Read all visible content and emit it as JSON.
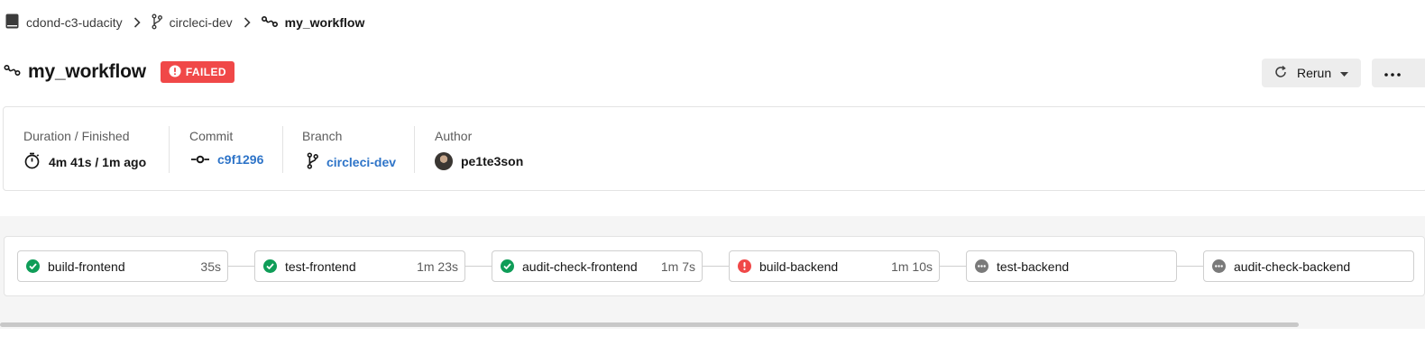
{
  "breadcrumb": {
    "project": "cdond-c3-udacity",
    "branch": "circleci-dev",
    "workflow": "my_workflow"
  },
  "header": {
    "title": "my_workflow",
    "status": "FAILED",
    "rerun_label": "Rerun"
  },
  "info": {
    "duration_label": "Duration / Finished",
    "duration_value": "4m 41s / 1m ago",
    "commit_label": "Commit",
    "commit_value": "c9f1296",
    "branch_label": "Branch",
    "branch_value": "circleci-dev",
    "author_label": "Author",
    "author_value": "pe1te3son"
  },
  "jobs": [
    {
      "name": "build-frontend",
      "duration": "35s",
      "status": "success"
    },
    {
      "name": "test-frontend",
      "duration": "1m 23s",
      "status": "success"
    },
    {
      "name": "audit-check-frontend",
      "duration": "1m 7s",
      "status": "success"
    },
    {
      "name": "build-backend",
      "duration": "1m 10s",
      "status": "failed"
    },
    {
      "name": "test-backend",
      "duration": "",
      "status": "not_run"
    },
    {
      "name": "audit-check-backend",
      "duration": "",
      "status": "not_run"
    }
  ],
  "colors": {
    "success": "#0f9d58",
    "failed": "#f04848",
    "not_run": "#7a7a7a",
    "link": "#2e74c8"
  },
  "icons": {
    "project": "book-icon",
    "branch": "branch-icon",
    "workflow": "workflow-icon",
    "duration": "stopwatch-icon",
    "commit": "commit-icon",
    "rerun": "refresh-icon",
    "more": "ellipsis-icon"
  }
}
